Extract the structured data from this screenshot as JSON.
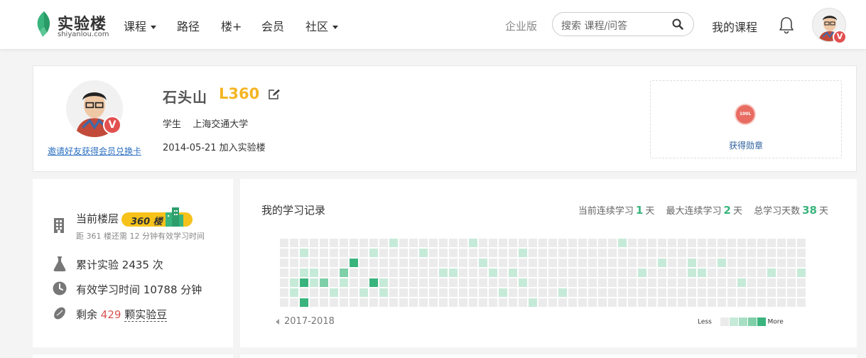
{
  "nav": {
    "logo_cn": "实验楼",
    "logo_en": "shiyanlou.com",
    "items": [
      {
        "label": "课程",
        "dropdown": true
      },
      {
        "label": "路径",
        "dropdown": false
      },
      {
        "label": "楼+",
        "dropdown": false
      },
      {
        "label": "会员",
        "dropdown": false
      },
      {
        "label": "社区",
        "dropdown": true
      }
    ],
    "enterprise": "企业版",
    "search_placeholder": "搜索 课程/问答",
    "my_courses": "我的课程",
    "icons": {
      "search": "search-icon",
      "notifications": "bell-icon",
      "avatar": "user-avatar"
    }
  },
  "profile": {
    "name": "石头山",
    "level": "L360",
    "role": "学生",
    "school": "上海交通大学",
    "joined": "2014-05-21 加入实验楼",
    "invite_link": "邀请好友获得会员兑换卡",
    "vip_badge": "V",
    "medal_text": "100L",
    "medal_label": "获得勋章"
  },
  "stats": {
    "floor_label": "当前楼层",
    "floor_badge": "360 楼",
    "floor_sub": "距 361 楼还需 12 分钟有效学习时间",
    "experiments_prefix": "累计实验",
    "experiments_value": "2435",
    "experiments_suffix": "次",
    "time_prefix": "有效学习时间",
    "time_value": "10788",
    "time_suffix": "分钟",
    "beans_prefix": "剩余",
    "beans_value": "429",
    "beans_suffix": "颗实验豆"
  },
  "record": {
    "title": "我的学习记录",
    "streak_label": "当前连续学习",
    "streak_value": "1",
    "max_label": "最大连续学习",
    "max_value": "2",
    "total_label": "总学习天数",
    "total_value": "38",
    "unit": "天",
    "year": "2017-2018",
    "legend_less": "Less",
    "legend_more": "More",
    "colors": [
      "#ebebeb",
      "#c6ead8",
      "#a8dfc4",
      "#7fcfa8",
      "#3ab47d"
    ],
    "weeks": 53,
    "days": 7,
    "active": [
      [
        1,
        5,
        1
      ],
      [
        1,
        4,
        1
      ],
      [
        2,
        1,
        1
      ],
      [
        2,
        3,
        1
      ],
      [
        2,
        4,
        4
      ],
      [
        2,
        6,
        4
      ],
      [
        3,
        3,
        1
      ],
      [
        3,
        4,
        1
      ],
      [
        4,
        4,
        3
      ],
      [
        5,
        5,
        1
      ],
      [
        6,
        3,
        3
      ],
      [
        6,
        4,
        1
      ],
      [
        7,
        2,
        4
      ],
      [
        8,
        5,
        1
      ],
      [
        9,
        1,
        1
      ],
      [
        9,
        4,
        4
      ],
      [
        10,
        4,
        1
      ],
      [
        10,
        5,
        1
      ],
      [
        11,
        0,
        1
      ],
      [
        14,
        1,
        1
      ],
      [
        16,
        3,
        1
      ],
      [
        17,
        3,
        1
      ],
      [
        19,
        0,
        1
      ],
      [
        20,
        2,
        1
      ],
      [
        21,
        3,
        1
      ],
      [
        22,
        5,
        1
      ],
      [
        23,
        3,
        1
      ],
      [
        24,
        1,
        1
      ],
      [
        24,
        4,
        1
      ],
      [
        25,
        6,
        1
      ],
      [
        28,
        5,
        1
      ],
      [
        34,
        0,
        1
      ],
      [
        36,
        3,
        1
      ],
      [
        38,
        2,
        1
      ],
      [
        41,
        3,
        1
      ],
      [
        41,
        2,
        1
      ],
      [
        42,
        3,
        1
      ],
      [
        44,
        2,
        1
      ],
      [
        46,
        4,
        1
      ],
      [
        49,
        3,
        1
      ],
      [
        52,
        3,
        1
      ]
    ]
  }
}
